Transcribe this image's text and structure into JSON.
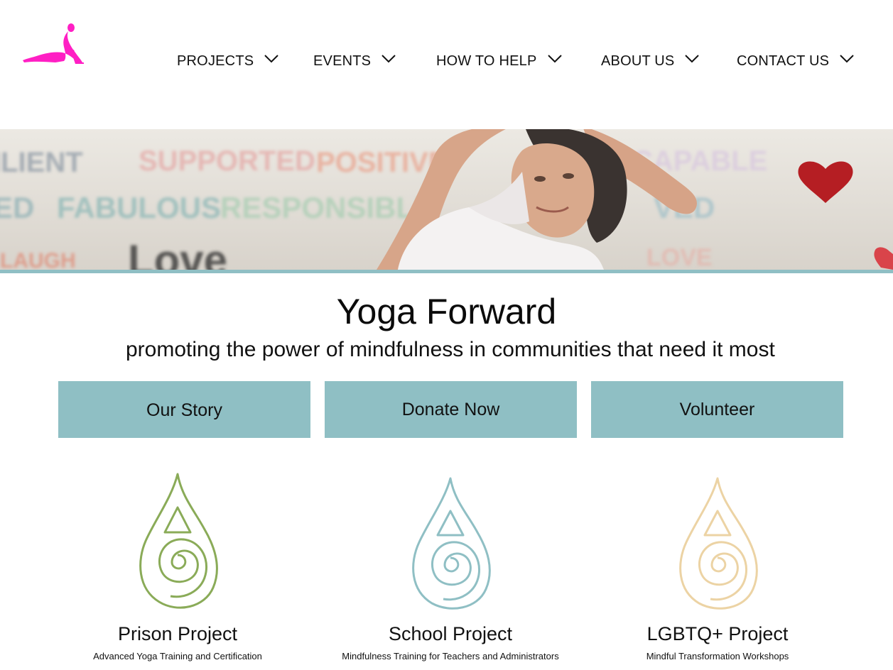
{
  "brand": {
    "accent": "#8fbfc4",
    "logo_color": "#ff1fc4",
    "logo": "yoga-pose-logo-icon"
  },
  "nav": {
    "items": [
      {
        "label": "PROJECTS",
        "icon": "chevron-down-icon"
      },
      {
        "label": "EVENTS",
        "icon": "chevron-down-icon"
      },
      {
        "label": "HOW TO HELP",
        "icon": "chevron-down-icon"
      },
      {
        "label": "ABOUT US",
        "icon": "chevron-down-icon"
      },
      {
        "label": "CONTACT US",
        "icon": "chevron-down-icon"
      }
    ]
  },
  "hero": {
    "image": "yoga-woman-stretching-photo"
  },
  "main": {
    "title": "Yoga Forward",
    "subtitle": "promoting the power of mindfulness in communities that need it most"
  },
  "cta": {
    "our_story": "Our Story",
    "donate": "Donate Now",
    "volunteer": "Volunteer"
  },
  "projects": [
    {
      "name": "Prison Project",
      "desc": "Advanced Yoga Training and Certification",
      "color": "#8aab58",
      "icon": "spiral-drop-icon"
    },
    {
      "name": "School Project",
      "desc": "Mindfulness Training for Teachers and Administrators",
      "color": "#8fbfc4",
      "icon": "spiral-drop-icon"
    },
    {
      "name": "LGBTQ+ Project",
      "desc": "Mindful Transformation Workshops",
      "color": "#ecd3a4",
      "icon": "spiral-drop-icon"
    }
  ]
}
